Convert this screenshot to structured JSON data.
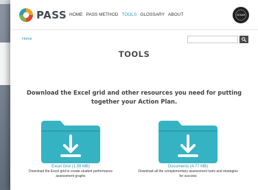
{
  "background": {
    "lines": [
      "ssed",
      "ns. W",
      "Check",
      "ility t",
      "t I d"
    ]
  },
  "header": {
    "logo_text": "PASS",
    "nav_items": [
      {
        "label": "HOME",
        "active": false
      },
      {
        "label": "PASS METHOD",
        "active": false
      },
      {
        "label": "TOOLS",
        "active": true
      },
      {
        "label": "GLOSSARY",
        "active": false
      },
      {
        "label": "ABOUT",
        "active": false
      }
    ],
    "badge_text": "CEDAR"
  },
  "breadcrumb": "Home",
  "search": {
    "value": "",
    "placeholder": ""
  },
  "page": {
    "title": "TOOLS",
    "subtitle": "Download the Excel grid and other resources you need for putting together your Action Plan."
  },
  "resources": [
    {
      "link": "Excel Grid (1.39 MB)",
      "description": "Download the Excel grid to create student performance assessment graphs"
    },
    {
      "link": "Documents (4.77 MB)",
      "description": "Download all the complementary assessment tools and strategies for success"
    }
  ],
  "colors": {
    "accent": "#2f9bb5",
    "folder": "#36b3c3",
    "folder_dark": "#2a9fb0",
    "text": "#444444"
  },
  "icons": {
    "logo": "pass-logo-icon",
    "search": "search-icon",
    "folder": "folder-download-icon"
  }
}
